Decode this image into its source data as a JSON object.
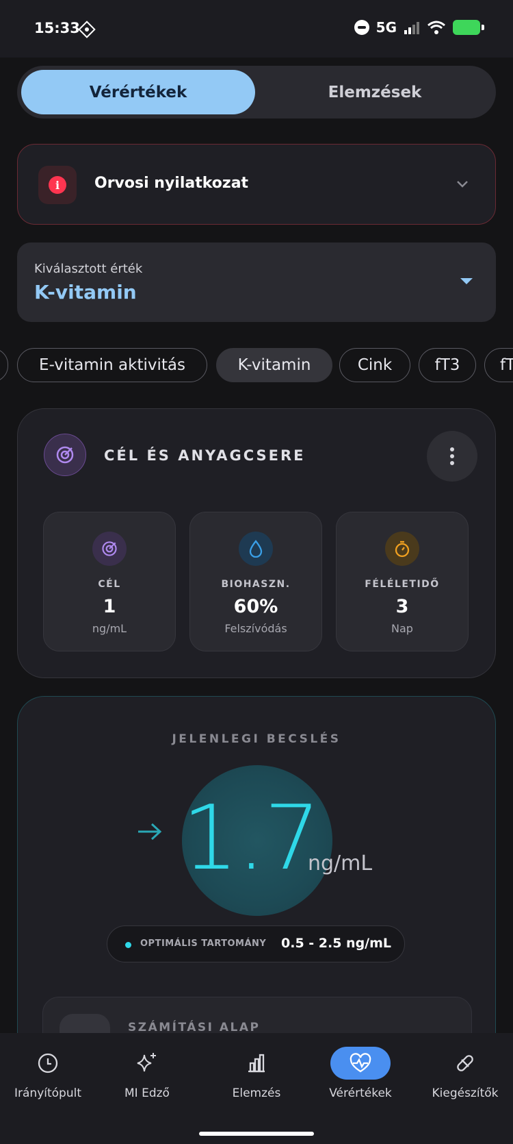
{
  "status": {
    "time": "15:33",
    "network": "5G"
  },
  "tabs": {
    "active": "Vérértékek",
    "inactive": "Elemzések"
  },
  "disclaimer": {
    "title": "Orvosi nyilatkozat",
    "icon": "info-icon",
    "color": "#ff3550"
  },
  "selector": {
    "label": "Kiválasztott érték",
    "value": "K-vitamin"
  },
  "chips": [
    {
      "label": "E-vitamin aktivitás"
    },
    {
      "label": "K-vitamin",
      "selected": true
    },
    {
      "label": "Cink"
    },
    {
      "label": "fT3"
    },
    {
      "label": "fT"
    }
  ],
  "goal_card": {
    "title": "CÉL ÉS ANYAGCSERE",
    "stats": [
      {
        "label": "CÉL",
        "value": "1",
        "sub": "ng/mL",
        "icon": "target-icon",
        "color": "#b08af0"
      },
      {
        "label": "BIOHASZN.",
        "value": "60%",
        "sub": "Felszívódás",
        "icon": "drop-icon",
        "color": "#3aa0e8"
      },
      {
        "label": "FÉLÉLETIDŐ",
        "value": "3",
        "sub": "Nap",
        "icon": "timer-icon",
        "color": "#f0a020"
      }
    ]
  },
  "estimate": {
    "title": "JELENLEGI BECSLÉS",
    "value": "1.7",
    "unit": "ng/mL",
    "range_label": "OPTIMÁLIS TARTOMÁNY",
    "range_value": "0.5 - 2.5 ng/mL",
    "accent": "#2fd8e8",
    "basis_title": "SZÁMÍTÁSI ALAP"
  },
  "nav": [
    {
      "label": "Irányítópult",
      "icon": "clock-icon"
    },
    {
      "label": "MI Edző",
      "icon": "sparkle-icon"
    },
    {
      "label": "Elemzés",
      "icon": "bar-chart-icon"
    },
    {
      "label": "Vérértékek",
      "icon": "heart-pulse-icon",
      "active": true
    },
    {
      "label": "Kiegészítők",
      "icon": "pill-icon"
    }
  ]
}
